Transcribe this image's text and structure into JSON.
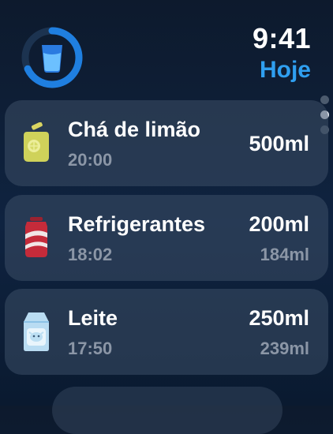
{
  "header": {
    "time": "9:41",
    "today_label": "Hoje",
    "progress_ring": {
      "icon": "water-glass-icon",
      "progress_fraction": 0.68,
      "track_color": "#1c3350",
      "fill_color": "#1f7fe0"
    }
  },
  "entries": [
    {
      "name": "Chá de limão",
      "time": "20:00",
      "amount": "500ml",
      "sub_amount": "",
      "icon": "lemon-tea-jar-icon"
    },
    {
      "name": "Refrigerantes",
      "time": "18:02",
      "amount": "200ml",
      "sub_amount": "184ml",
      "icon": "soda-can-icon"
    },
    {
      "name": "Leite",
      "time": "17:50",
      "amount": "250ml",
      "sub_amount": "239ml",
      "icon": "milk-carton-icon"
    }
  ],
  "colors": {
    "accent": "#2f9ff0",
    "card": "#3c4e66",
    "muted_text": "#8b96a6"
  }
}
